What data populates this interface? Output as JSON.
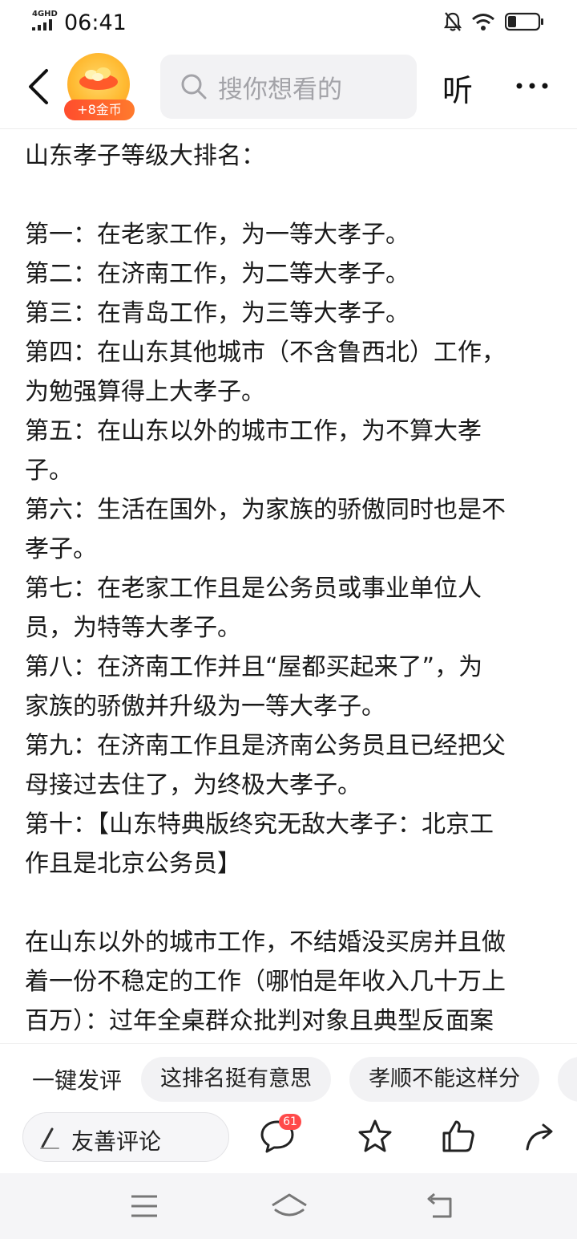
{
  "status_bar": {
    "network": "4GHD",
    "time": "06:41",
    "icons": [
      "signal-icon",
      "bell-muted-icon",
      "wifi-icon",
      "battery-icon"
    ]
  },
  "nav": {
    "back_icon": "chevron-left-icon",
    "coin_badge": "+8金币",
    "search_placeholder": "搜你想看的",
    "listen": "听",
    "more_icon": "more-dots-icon"
  },
  "article": {
    "paragraphs": [
      "山东孝子等级大排名：",
      "",
      "第一：在老家工作，为一等大孝子。\n第二：在济南工作，为二等大孝子。\n第三：在青岛工作，为三等大孝子。\n第四：在山东其他城市（不含鲁西北）工作，\n为勉强算得上大孝子。\n第五：在山东以外的城市工作，为不算大孝\n子。\n第六：生活在国外，为家族的骄傲同时也是不\n孝子。\n第七：在老家工作且是公务员或事业单位人\n员，为特等大孝子。\n第八：在济南工作并且“屋都买起来了”，为\n家族的骄傲并升级为一等大孝子。\n第九：在济南工作且是济南公务员且已经把父\n母接过去住了，为终极大孝子。\n第十：【山东特典版终究无敌大孝子：北京工\n作且是北京公务员】",
      "",
      "在山东以外的城市工作，不结婚没买房并且做\n着一份不稳定的工作（哪怕是年收入几十万上\n百万）：过年全桌群众批判对象且典型反面案"
    ]
  },
  "quick_comments": {
    "label": "一键发评",
    "chips": [
      "这排名挺有意思",
      "孝顺不能这样分",
      ""
    ]
  },
  "action_bar": {
    "comment_placeholder": "友善评论",
    "comment_count": "61",
    "icons": [
      "pen-icon",
      "comments-icon",
      "star-icon",
      "like-icon",
      "share-icon"
    ]
  },
  "system_nav": {
    "icons": [
      "menu-icon",
      "home-icon",
      "back-return-icon"
    ]
  },
  "colors": {
    "accent_red": "#ff4a4a",
    "coin_orange": "#ff7a2d",
    "search_bg": "#f2f2f4"
  }
}
